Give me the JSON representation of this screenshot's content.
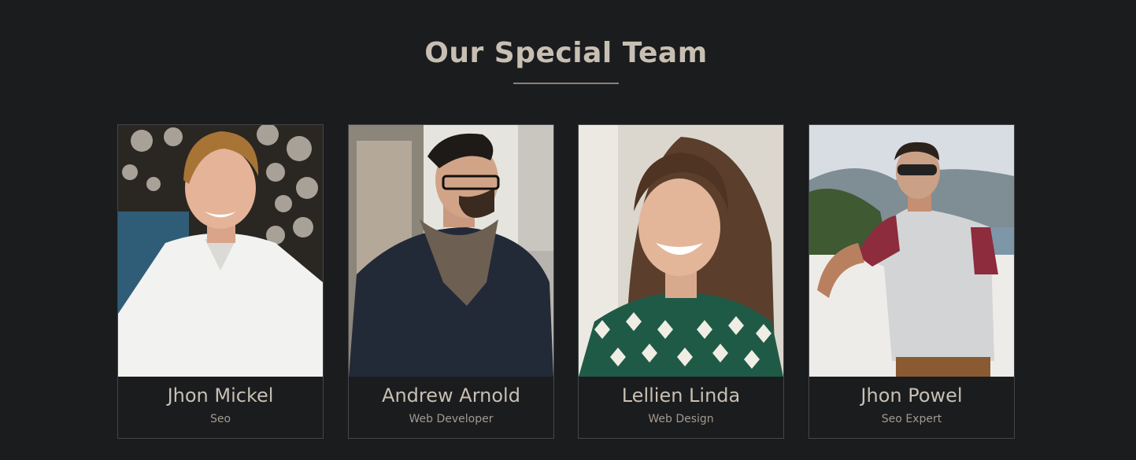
{
  "section": {
    "title": "Our Special Team"
  },
  "members": [
    {
      "name": "Jhon Mickel",
      "role": "Seo",
      "photo_icon": "portrait-photo"
    },
    {
      "name": "Andrew Arnold",
      "role": "Web Developer",
      "photo_icon": "portrait-photo"
    },
    {
      "name": "Lellien Linda",
      "role": "Web Design",
      "photo_icon": "portrait-photo"
    },
    {
      "name": "Jhon Powel",
      "role": "Seo Expert",
      "photo_icon": "portrait-photo"
    }
  ],
  "colors": {
    "background": "#1b1c1e",
    "title": "#c8bfb3",
    "accent_rule": "#8a8178",
    "card_border": "#44464a",
    "role_text": "#a29a91"
  }
}
